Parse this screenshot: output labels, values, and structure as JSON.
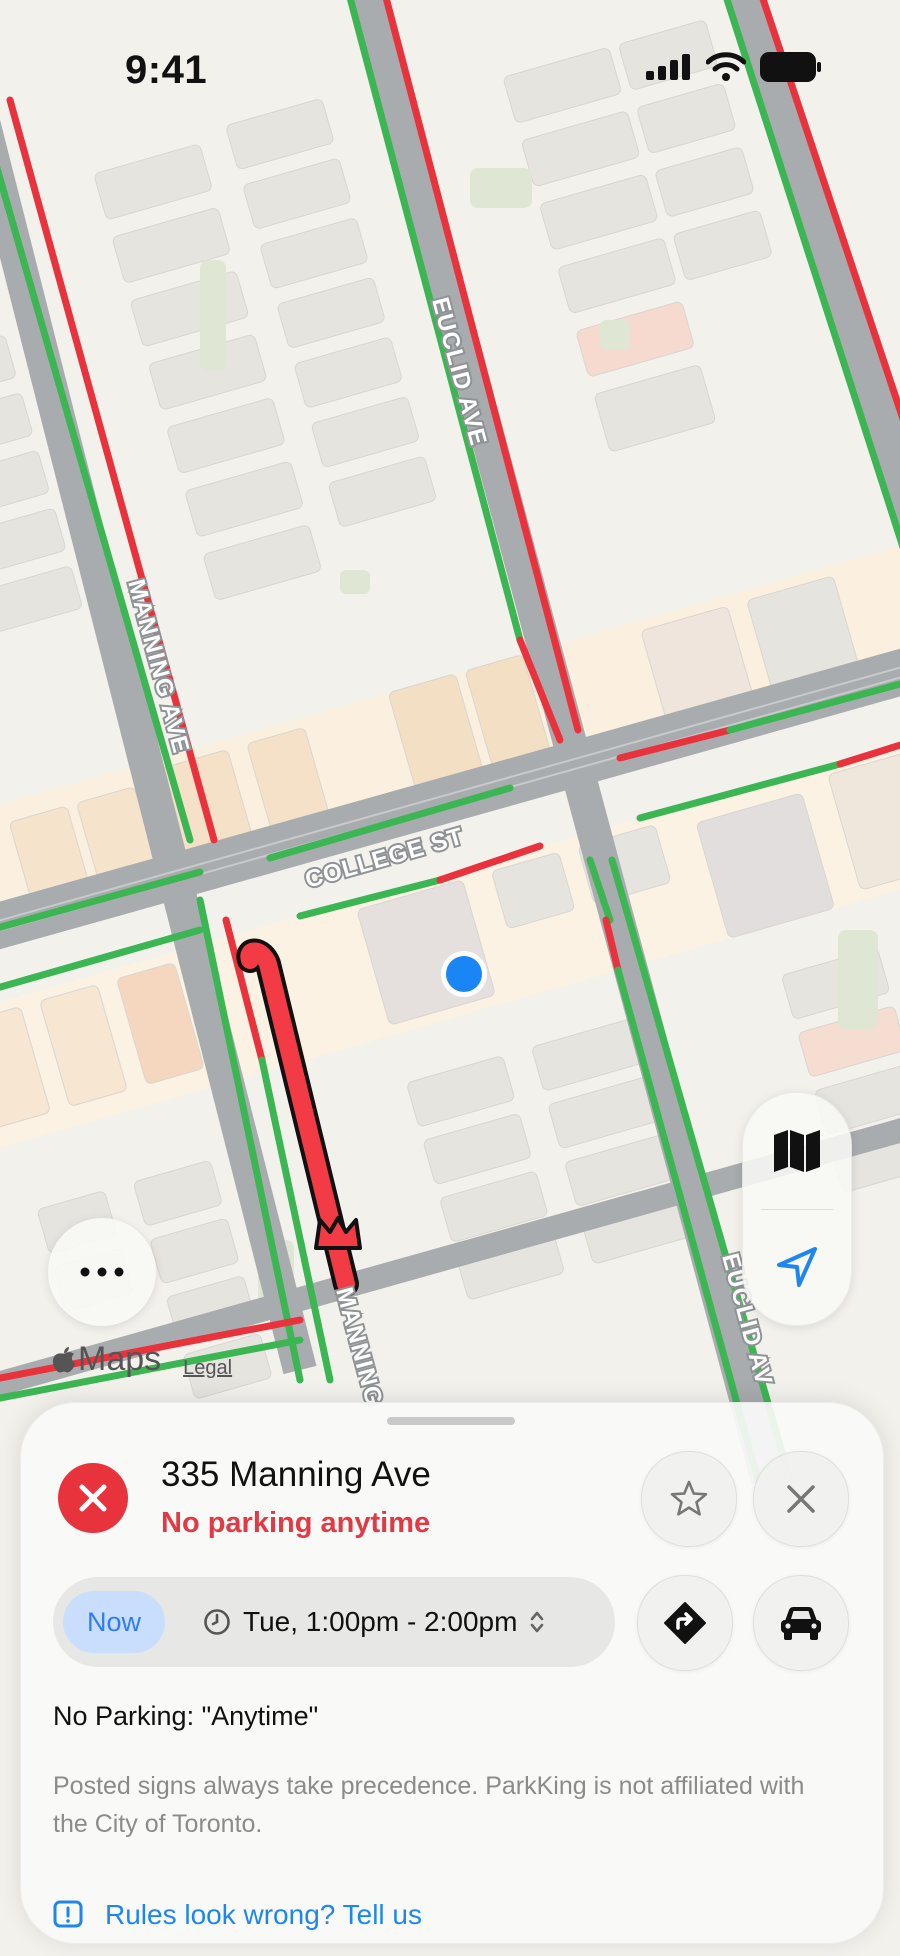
{
  "status_bar": {
    "time": "9:41"
  },
  "map": {
    "streets": [
      "EUCLID AVE",
      "MANNING AVE",
      "COLLEGE ST",
      "MANNING",
      "EUCLID AV"
    ],
    "attribution": {
      "logo_text": "Maps",
      "legal": "Legal"
    },
    "colors": {
      "allowed": "#3cb553",
      "restricted": "#e8333d",
      "road": "#a9acae",
      "user_location": "#1a86f5"
    }
  },
  "controls": {
    "map_mode_icon": "map-icon",
    "locate_icon": "location-arrow-icon",
    "more_icon": "ellipsis-icon"
  },
  "sheet": {
    "address": "335 Manning Ave",
    "rule_short": "No parking anytime",
    "now_label": "Now",
    "time_range": "Tue, 1:00pm - 2:00pm",
    "rule_detail": "No Parking: \"Anytime\"",
    "disclaimer": "Posted signs always take precedence. ParkKing is not affiliated with the City of Toronto.",
    "feedback": "Rules look wrong? Tell us",
    "accent": "#1f86f0",
    "warning": "#e23a44"
  }
}
